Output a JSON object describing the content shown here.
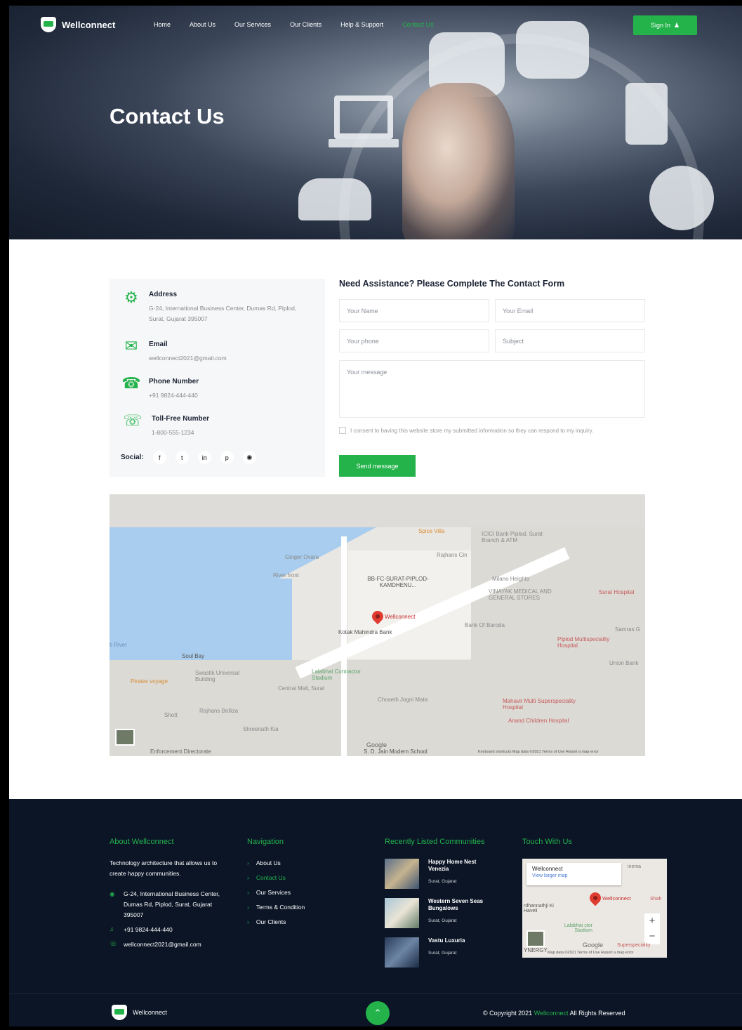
{
  "nav": {
    "brand": "Wellconnect",
    "items": [
      "Home",
      "About Us",
      "Our Services",
      "Our Clients",
      "Help & Support",
      "Contact Us"
    ],
    "active_index": 5,
    "signin_label": "Sign In"
  },
  "hero": {
    "title": "Contact Us"
  },
  "contact_info": {
    "address_label": "Address",
    "address_value": "G-24, International Business Center, Dumas Rd, Piplod, Surat, Gujarat 395007",
    "email_label": "Email",
    "email_value": "wellconnect2021@gmail.com",
    "phone_label": "Phone Number",
    "phone_value": "+91 9824-444-440",
    "tollfree_label": "Toll-Free Number",
    "tollfree_value": "1-800-555-1234",
    "social_label": "Social:",
    "social_icons": [
      "facebook-icon",
      "twitter-icon",
      "linkedin-icon",
      "pinterest-icon",
      "instagram-icon"
    ]
  },
  "form": {
    "title": "Need Assistance? Please Complete The Contact Form",
    "name_placeholder": "Your Name",
    "email_placeholder": "Your Email",
    "phone_placeholder": "Your phone",
    "subject_placeholder": "Subject",
    "message_placeholder": "Your message",
    "consent_text": "I consent to having this website store my submitted information so they can respond to my inquiry.",
    "submit_label": "Send message"
  },
  "map": {
    "labels": {
      "spice_villa": "Spice Villa",
      "icici": "ICICI Bank Piplod, Surat Branch & ATM",
      "ginger": "Ginger Ovara",
      "rajhans_cin": "Rajhans Cin",
      "river_front": "River front",
      "bbfc": "BB-FC-SURAT-PIPLOD-KAMDHENU...",
      "milano": "Milano Heights",
      "vinayak": "VINAYAK MEDICAL AND GENERAL STORES",
      "surat_hospital": "Surat Hospital",
      "marker": "Wellconnect",
      "kotak": "Kotak Mahindra Bank",
      "bank_baroda": "Bank Of Baroda",
      "samras": "Samras G",
      "pipload_multi": "Piplod Multispeciality Hospital",
      "river": "ti River",
      "soul_bay": "Soul Bay",
      "union": "Union Bank",
      "swastik": "Swastik Universal Building",
      "lalabhai": "Lalabhai Contractor Stadium",
      "pirates": "Pirates voyage",
      "central_mall": "Central Mall, Surat",
      "choseth": "Choseth Jogni Mata",
      "mahavir": "Mahavir Multi Superspeciality Hospital",
      "shott": "Shott",
      "rajhans_belliza": "Rajhans Belliza",
      "anand": "Anand Children Hospital",
      "shreenath": "Shreenath Kia",
      "enforcement": "Enforcement Directorate",
      "google": "Google",
      "sd_jain": "S. D. Jain Modern School",
      "footer_text": "Keyboard shortcuts   Map data ©2021   Terms of Use   Report a map error"
    }
  },
  "footer": {
    "about_title": "About Wellconnect",
    "about_text": "Technology architecture that allows us to create happy communities.",
    "address": "G-24, International Business Center, Dumas Rd, Piplod, Surat, Gujarat 395007",
    "phone": "+91 9824-444-440",
    "email": "wellconnect2021@gmail.com",
    "nav_title": "Navigation",
    "nav_links": [
      "About Us",
      "Contact Us",
      "Our Services",
      "Terms & Condition",
      "Our Clients"
    ],
    "nav_active_index": 1,
    "communities_title": "Recently Listed Communities",
    "communities": [
      {
        "name": "Happy Home Nest Venezia",
        "location": "Surat, Gujarat"
      },
      {
        "name": "Western Seven Seas Bungalows",
        "location": "Surat, Gujarat"
      },
      {
        "name": "Vastu Luxuria",
        "location": "Surat, Gujarat"
      }
    ],
    "touch_title": "Touch With Us",
    "minimap": {
      "place": "Wellconnect",
      "larger": "View larger map",
      "cinema": "inema",
      "marker": "Wellconnect",
      "shah": "Shah",
      "haveli": "rdhannathji Ki Haveli",
      "stadium": "Lalabhai ctor Stadium",
      "google": "Google",
      "superspec": "Superspeciality",
      "yner": "YNERGY",
      "footer": "Map data ©2021   Terms of Use   Report a map error"
    },
    "bottom_brand": "Wellconnect",
    "copyright_prefix": "© Copyright 2021",
    "copyright_brand": "Wellconnect",
    "copyright_suffix": "All Rights Reserved"
  },
  "colors": {
    "accent": "#24b34b",
    "footer_bg": "#0b1526"
  }
}
